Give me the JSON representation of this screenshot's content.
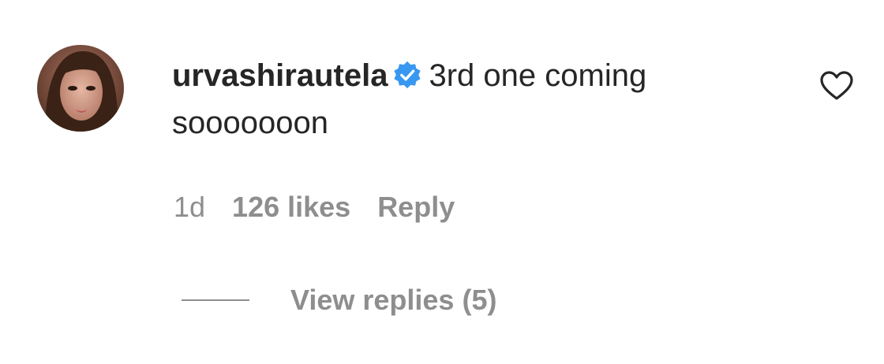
{
  "comment": {
    "avatar_icon": "profile-avatar",
    "username": "urvashirautela",
    "verified_icon": "verified-badge-icon",
    "verified_color": "#3897f0",
    "text": "3rd one coming sooooooon",
    "like_icon": "heart-outline-icon"
  },
  "meta": {
    "time": "1d",
    "likes": "126 likes",
    "reply_label": "Reply"
  },
  "replies": {
    "label": "View replies (5)"
  }
}
